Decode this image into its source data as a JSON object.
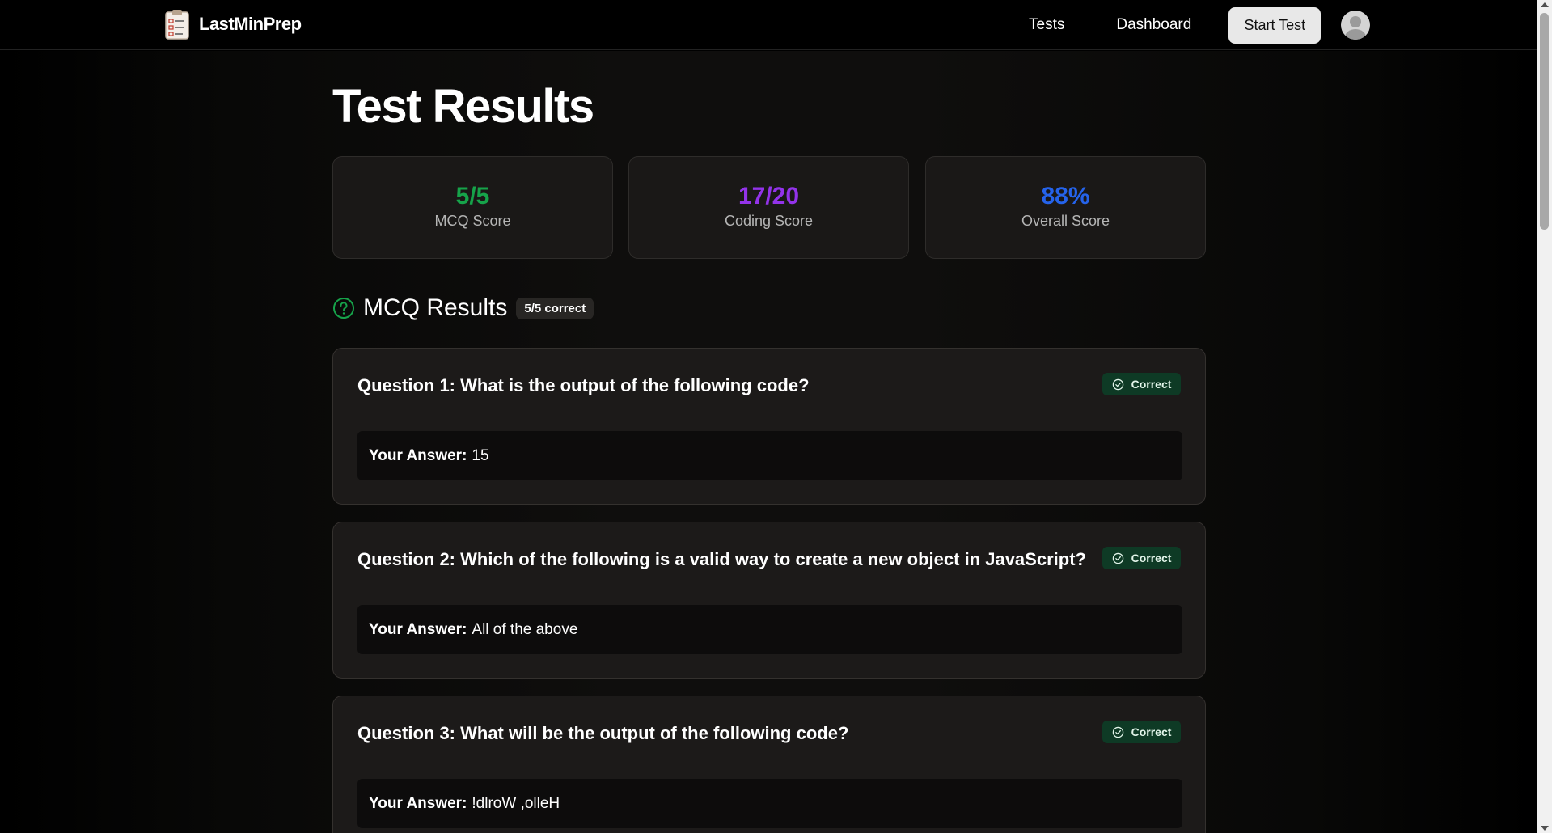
{
  "navbar": {
    "brand": "LastMinPrep",
    "brand_icon": "clipboard-icon",
    "links": [
      "Tests",
      "Dashboard"
    ],
    "start_button": "Start Test",
    "avatar_icon": "user-avatar-icon"
  },
  "page": {
    "title": "Test Results"
  },
  "scores": [
    {
      "value": "5/5",
      "label": "MCQ Score",
      "color": "#16a34a"
    },
    {
      "value": "17/20",
      "label": "Coding Score",
      "color": "#9333ea"
    },
    {
      "value": "88%",
      "label": "Overall Score",
      "color": "#2563eb"
    }
  ],
  "mcq": {
    "icon": "help-circle-icon",
    "title": "MCQ Results",
    "count_badge": "5/5 correct",
    "answer_label": "Your Answer:",
    "questions": [
      {
        "title": "Question 1: What is the output of the following code?",
        "status": "Correct",
        "answer": "15"
      },
      {
        "title": "Question 2: Which of the following is a valid way to create a new object in JavaScript?",
        "status": "Correct",
        "answer": "All of the above"
      },
      {
        "title": "Question 3: What will be the output of the following code?",
        "status": "Correct",
        "answer": "!dlroW ,olleH"
      }
    ]
  },
  "colors": {
    "accent_green": "#16a34a",
    "accent_purple": "#9333ea",
    "accent_blue": "#2563eb",
    "badge_bg": "#0e3a25"
  }
}
